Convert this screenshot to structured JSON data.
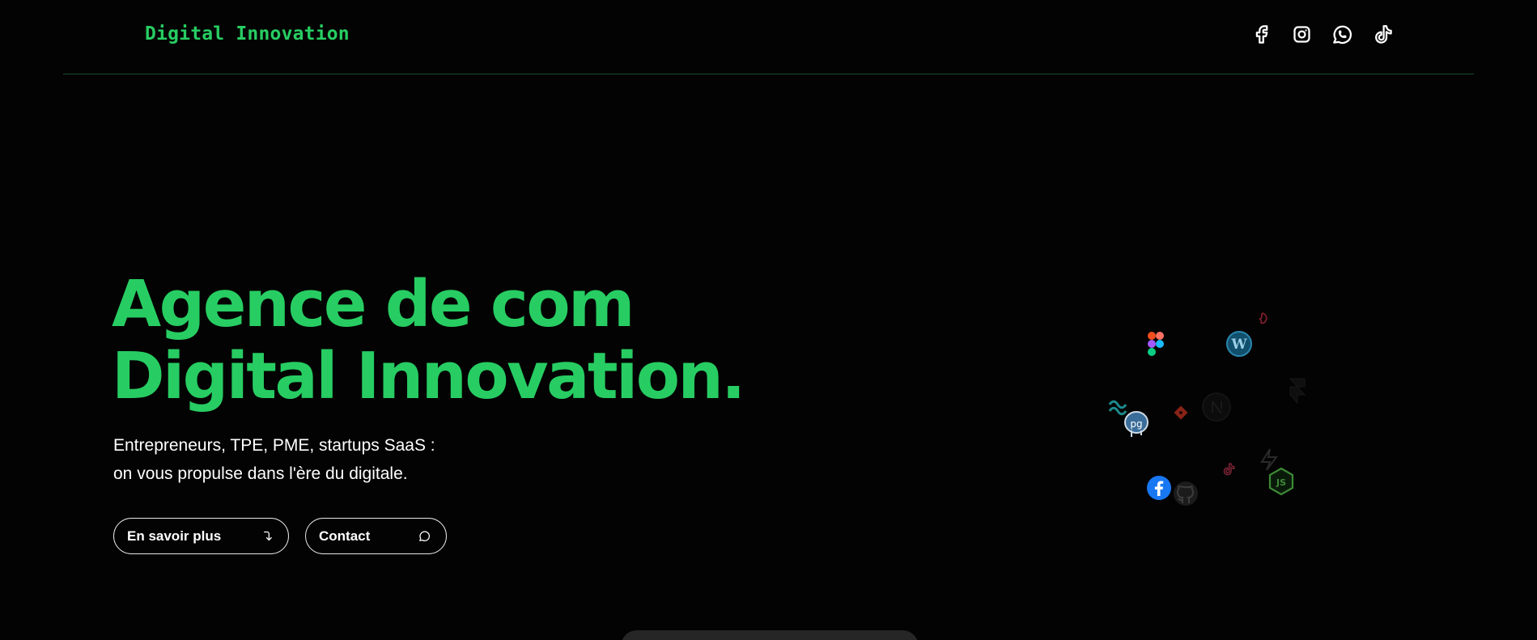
{
  "header": {
    "brand": "Digital Innovation",
    "socials": [
      {
        "icon": "facebook-icon"
      },
      {
        "icon": "instagram-icon"
      },
      {
        "icon": "whatsapp-icon"
      },
      {
        "icon": "tiktok-icon"
      }
    ]
  },
  "hero": {
    "title_line1": "Agence de com",
    "title_line2": "Digital Innovation.",
    "subtitle_line1": "Entrepreneurs, TPE, PME, startups SaaS :",
    "subtitle_line2": "on vous propulse dans l'ère du digitale.",
    "buttons": {
      "more_label": "En savoir plus",
      "more_icon": "arrow-down-turn-icon",
      "contact_label": "Contact",
      "contact_icon": "chat-bubble-icon"
    }
  },
  "tech_cloud": {
    "icons": [
      "figma-icon",
      "wordpress-icon",
      "nestjs-icon",
      "tailwind-icon",
      "postgresql-icon",
      "git-icon",
      "nextjs-icon",
      "framer-icon",
      "tiktok-icon",
      "laravel-icon",
      "facebook-icon",
      "github-icon",
      "nodejs-icon"
    ]
  },
  "colors": {
    "accent": "#27cd62",
    "background": "#030303",
    "text": "#ffffff",
    "divider": "#184a2a"
  }
}
